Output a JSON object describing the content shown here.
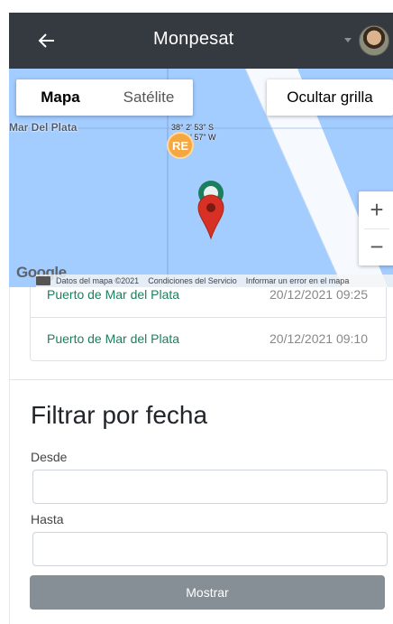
{
  "navbar": {
    "title": "Monpesat",
    "back_icon": "arrow-left-icon",
    "caret_icon": "caret-down-icon",
    "avatar": "user-avatar"
  },
  "map": {
    "type_buttons": [
      "Mapa",
      "Satélite"
    ],
    "selected_type": "Mapa",
    "grid_button": "Ocultar grilla",
    "city_label": "Mar Del Plata",
    "coord_lat": "38° 2' 53\" S",
    "coord_lon": "57° 1' 57\" W",
    "marker_badge": "RE",
    "zoom_in": "+",
    "zoom_out": "−",
    "google_logo": "Google",
    "attribution": {
      "data": "Datos del mapa ©2021",
      "terms": "Condiciones del Servicio",
      "report": "Informar un error en el mapa"
    },
    "colors": {
      "water": "#a3ccff",
      "pin": "#d93025",
      "pin_green": "#1b7f5f",
      "badge": "#f5a742"
    }
  },
  "entries": [
    {
      "place": "Puerto de Mar del Plata",
      "datetime": "20/12/2021 09:25"
    },
    {
      "place": "Puerto de Mar del Plata",
      "datetime": "20/12/2021 09:10"
    }
  ],
  "filter": {
    "title": "Filtrar por fecha",
    "from_label": "Desde",
    "to_label": "Hasta",
    "from_value": "",
    "to_value": "",
    "submit_label": "Mostrar"
  }
}
